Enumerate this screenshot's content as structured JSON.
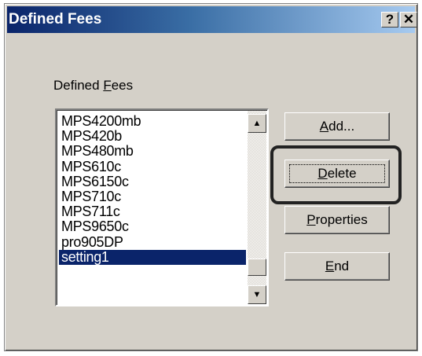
{
  "window": {
    "title": "Defined Fees",
    "help_label": "?",
    "close_label": "✕"
  },
  "group_label": {
    "before": "Defined ",
    "accel": "F",
    "after": "ees"
  },
  "list": {
    "items": [
      "MPS4200mb",
      "MPS420b",
      "MPS480mb",
      "MPS610c",
      "MPS6150c",
      "MPS710c",
      "MPS711c",
      "MPS9650c",
      "pro905DP",
      "setting1"
    ],
    "selected_index": 9
  },
  "buttons": {
    "add": {
      "accel": "A",
      "rest": "dd..."
    },
    "delete": {
      "accel": "D",
      "rest": "elete"
    },
    "properties": {
      "accel": "P",
      "rest": "roperties"
    },
    "end": {
      "accel": "E",
      "rest": "nd"
    }
  },
  "colors": {
    "selection": "#0a246a",
    "face": "#d4d0c8",
    "title_gradient_start": "#0a246a",
    "title_gradient_end": "#a6caf0"
  }
}
